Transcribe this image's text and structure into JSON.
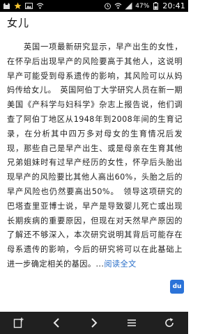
{
  "status_bar": {
    "left_icons": [
      "cat-icon",
      "star-icon",
      "image-icon",
      "wifi-icon"
    ],
    "right_icons": [
      "alarm-icon",
      "wifi-icon",
      "signal-icon",
      "battery-icon"
    ],
    "battery": "47%",
    "time": "20:41"
  },
  "article": {
    "title": "女儿",
    "body": "　　英国一项最新研究显示，早产出生的女性，在怀孕后出现早产的风险要高于其他人，这说明早产可能受到母系遗传的影响，其风险可以从妈妈传给女儿。　英国阿伯丁大学研究人员在新一期美国《产科学与妇科学》杂志上报告说，他们调查了阿伯丁地区从1948年到2008年间的生育记录，在分析其中四万多对母女的生育情况后发现，那些自己是早产出生、或是母亲在生育其他兄弟姐妹时有过早产经历的女性，怀孕后头胎出现早产的风险要比其他人高出60%，头胎之后的早产风险也仍然要高出50%。　领导这项研究的巴塔查里亚博士说，早产是导致婴儿死亡或出现长期疾病的重要原因，但现在对天然早产原因的了解还不够深入，本次研究说明其背后可能存在母系遗传的影响，今后的研究将可以在此基础上进一步确定相关的基因。",
    "ellipsis": "...",
    "read_more": "阅读全文"
  },
  "badge": {
    "label": "du"
  },
  "colors": {
    "link": "#2a6fc9",
    "badge": "#2b73d8",
    "bar": "#202020"
  },
  "nav_icons": [
    "bookmark-add-icon",
    "back-icon",
    "forward-icon",
    "menu-icon",
    "refresh-icon"
  ]
}
